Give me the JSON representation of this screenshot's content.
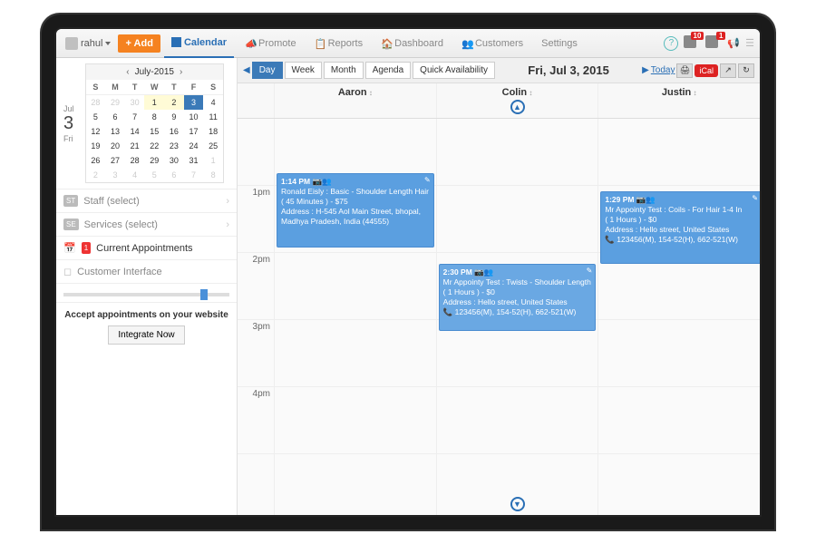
{
  "user": {
    "name": "rahul"
  },
  "buttons": {
    "add": "+ Add",
    "integrate": "Integrate Now",
    "today": "Today"
  },
  "nav": {
    "calendar": "Calendar",
    "promote": "Promote",
    "reports": "Reports",
    "dashboard": "Dashboard",
    "customers": "Customers",
    "settings": "Settings"
  },
  "notifications": {
    "count1": "10",
    "count2": "1"
  },
  "currentDate": {
    "monthShort": "Jul",
    "dayNum": "3",
    "dow": "Fri"
  },
  "miniCal": {
    "title": "July-2015",
    "dow": [
      "S",
      "M",
      "T",
      "W",
      "T",
      "F",
      "S"
    ],
    "rows": [
      [
        {
          "v": "28",
          "dim": true
        },
        {
          "v": "29",
          "dim": true
        },
        {
          "v": "30",
          "dim": true
        },
        {
          "v": "1",
          "hl": true
        },
        {
          "v": "2",
          "hl": true
        },
        {
          "v": "3",
          "sel": true
        },
        {
          "v": "4"
        }
      ],
      [
        {
          "v": "5"
        },
        {
          "v": "6"
        },
        {
          "v": "7"
        },
        {
          "v": "8"
        },
        {
          "v": "9"
        },
        {
          "v": "10"
        },
        {
          "v": "11"
        }
      ],
      [
        {
          "v": "12"
        },
        {
          "v": "13"
        },
        {
          "v": "14"
        },
        {
          "v": "15"
        },
        {
          "v": "16"
        },
        {
          "v": "17"
        },
        {
          "v": "18"
        }
      ],
      [
        {
          "v": "19"
        },
        {
          "v": "20"
        },
        {
          "v": "21"
        },
        {
          "v": "22"
        },
        {
          "v": "23"
        },
        {
          "v": "24"
        },
        {
          "v": "25"
        }
      ],
      [
        {
          "v": "26"
        },
        {
          "v": "27"
        },
        {
          "v": "28"
        },
        {
          "v": "29"
        },
        {
          "v": "30"
        },
        {
          "v": "31"
        },
        {
          "v": "1",
          "dim": true
        }
      ],
      [
        {
          "v": "2",
          "dim": true
        },
        {
          "v": "3",
          "dim": true
        },
        {
          "v": "4",
          "dim": true
        },
        {
          "v": "5",
          "dim": true
        },
        {
          "v": "6",
          "dim": true
        },
        {
          "v": "7",
          "dim": true
        },
        {
          "v": "8",
          "dim": true
        }
      ]
    ]
  },
  "sideItems": {
    "staff": {
      "tag": "ST",
      "label": "Staff (select)"
    },
    "services": {
      "tag": "SE",
      "label": "Services (select)"
    },
    "current": {
      "label": "Current Appointments",
      "badge": "1"
    },
    "customerInterface": {
      "label": "Customer Interface"
    }
  },
  "sideCta": {
    "text": "Accept appointments on your website"
  },
  "calViews": {
    "day": "Day",
    "week": "Week",
    "month": "Month",
    "agenda": "Agenda",
    "quick": "Quick Availability"
  },
  "calTitle": "Fri, Jul 3, 2015",
  "ical": "iCal",
  "staff": [
    "Aaron",
    "Colin",
    "Justin"
  ],
  "timeSlots": [
    "",
    "1pm",
    "2pm",
    "3pm",
    "4pm"
  ],
  "appts": {
    "a1": {
      "time": "1:14 PM",
      "line1": "Ronald Eisly : Basic - Shoulder Length Hair",
      "line2": "( 45 Minutes ) - $75",
      "line3": "Address : H-545 Aol Main Street, bhopal,",
      "line4": "Madhya Pradesh, India (44555)"
    },
    "a2": {
      "time": "2:30 PM",
      "line1": "Mr Appointy Test : Twists - Shoulder Length",
      "line2": "( 1 Hours ) - $0",
      "line3": "Address : Hello street, United States",
      "line4": "123456(M), 154-52(H), 662-521(W)"
    },
    "a3": {
      "time": "1:29 PM",
      "line1": "Mr Appointy Test : Coils - For Hair 1-4 In",
      "line2": "( 1 Hours ) - $0",
      "line3": "Address : Hello street, United States",
      "line4": "123456(M), 154-52(H), 662-521(W)"
    }
  }
}
